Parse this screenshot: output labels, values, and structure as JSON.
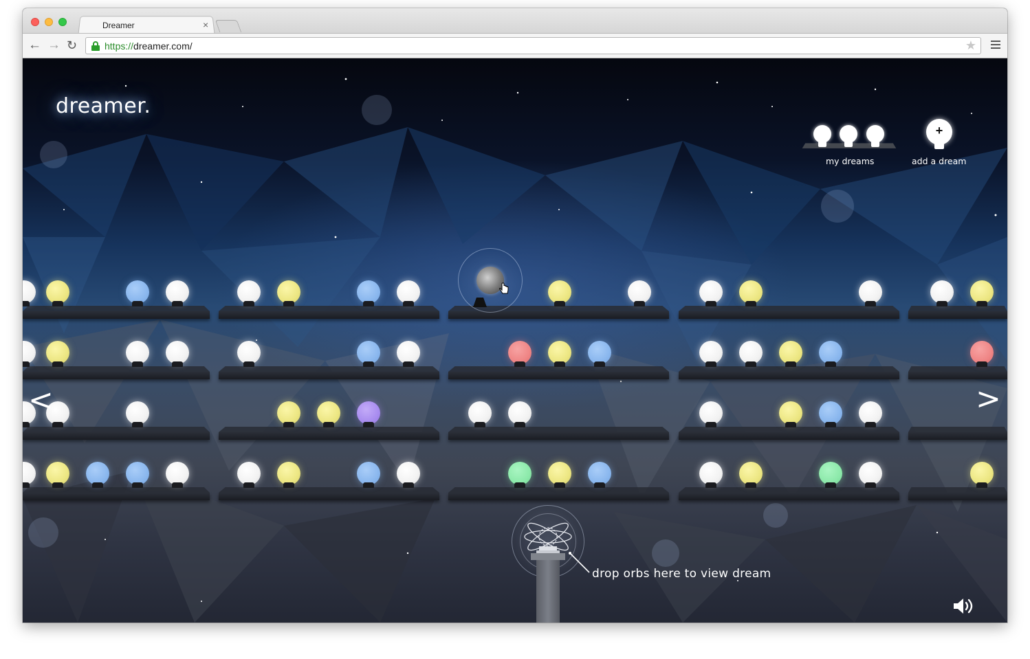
{
  "browser": {
    "tab_title": "Dreamer",
    "tab_close": "×",
    "url_scheme": "https://",
    "url_rest": "dreamer.com/",
    "back": "←",
    "forward": "→",
    "reload": "↻",
    "star": "★"
  },
  "page": {
    "logo": "dreamer.",
    "my_dreams_label": "my dreams",
    "add_dream_label": "add a dream",
    "add_plus": "+",
    "prev_arrow": "<",
    "next_arrow": ">",
    "drop_hint": "drop orbs here to view dream"
  },
  "shelves": [
    {
      "row": 1,
      "orbs": [
        "white",
        "yellow",
        "blue",
        "white",
        "white",
        "yellow",
        "blue",
        "white",
        "yellow",
        "white",
        "white",
        "yellow",
        "white",
        "white",
        "yellow"
      ]
    },
    {
      "row": 2,
      "orbs": [
        "white",
        "yellow",
        "white",
        "white",
        "white",
        "blue",
        "white",
        "red",
        "yellow",
        "blue",
        "white",
        "white",
        "yellow",
        "blue",
        "red"
      ]
    },
    {
      "row": 3,
      "orbs": [
        "white",
        "white",
        "white",
        "yellow",
        "yellow",
        "purple",
        "white",
        "white",
        "white",
        "yellow",
        "blue",
        "white"
      ]
    },
    {
      "row": 4,
      "orbs": [
        "white",
        "yellow",
        "blue",
        "blue",
        "white",
        "white",
        "yellow",
        "blue",
        "white",
        "green",
        "yellow",
        "blue",
        "white",
        "yellow",
        "green",
        "white",
        "yellow"
      ]
    }
  ],
  "icons": {
    "lock": "lock-icon",
    "menu": "hamburger-menu-icon",
    "sound": "speaker-icon",
    "pedestal": "atom-icon"
  }
}
